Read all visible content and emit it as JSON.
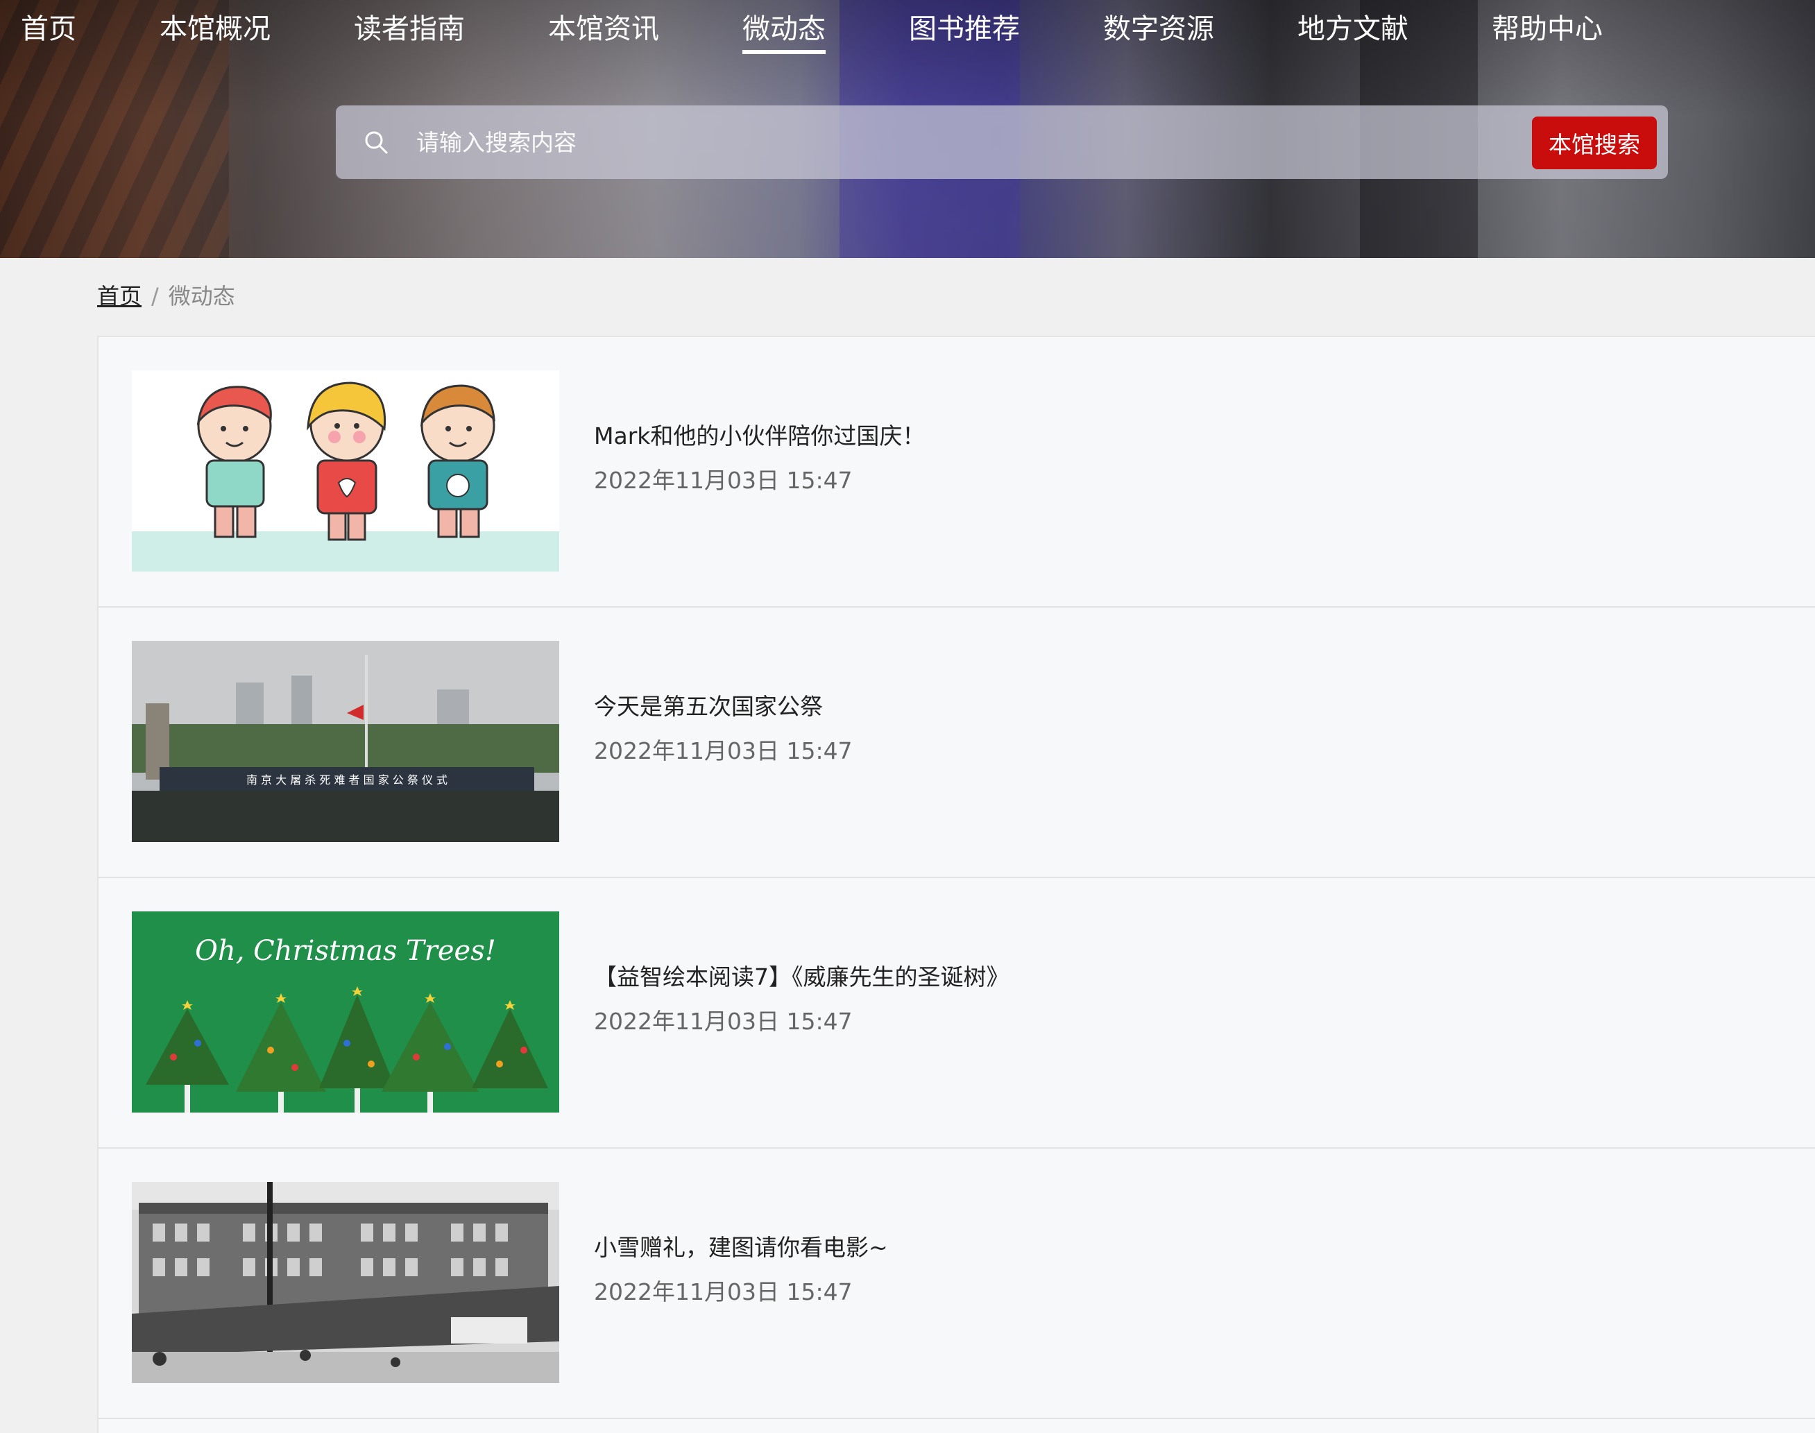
{
  "nav": {
    "items": [
      {
        "label": "首页",
        "active": false
      },
      {
        "label": "本馆概况",
        "active": false
      },
      {
        "label": "读者指南",
        "active": false
      },
      {
        "label": "本馆资讯",
        "active": false
      },
      {
        "label": "微动态",
        "active": true
      },
      {
        "label": "图书推荐",
        "active": false
      },
      {
        "label": "数字资源",
        "active": false
      },
      {
        "label": "地方文献",
        "active": false
      },
      {
        "label": "帮助中心",
        "active": false
      }
    ]
  },
  "search": {
    "placeholder": "请输入搜索内容",
    "button_label": "本馆搜索",
    "icon": "search-icon"
  },
  "breadcrumb": {
    "home": "首页",
    "separator": "/",
    "current": "微动态"
  },
  "articles": [
    {
      "title": "Mark和他的小伙伴陪你过国庆！",
      "time": "2022年11月03日 15:47"
    },
    {
      "title": "今天是第五次国家公祭",
      "time": "2022年11月03日 15:47",
      "image_text": "南 京 大 屠 杀 死 难 者 国 家 公 祭 仪 式"
    },
    {
      "title": "【益智绘本阅读7】《威廉先生的圣诞树》",
      "time": "2022年11月03日 15:47",
      "image_text": "Oh, Christmas Trees!"
    },
    {
      "title": "小雪赠礼，建图请你看电影~",
      "time": "2022年11月03日 15:47"
    }
  ],
  "colors": {
    "search_button": "#c90c0c",
    "page_background": "#f0f0f0",
    "list_background": "#f7f8fa"
  }
}
